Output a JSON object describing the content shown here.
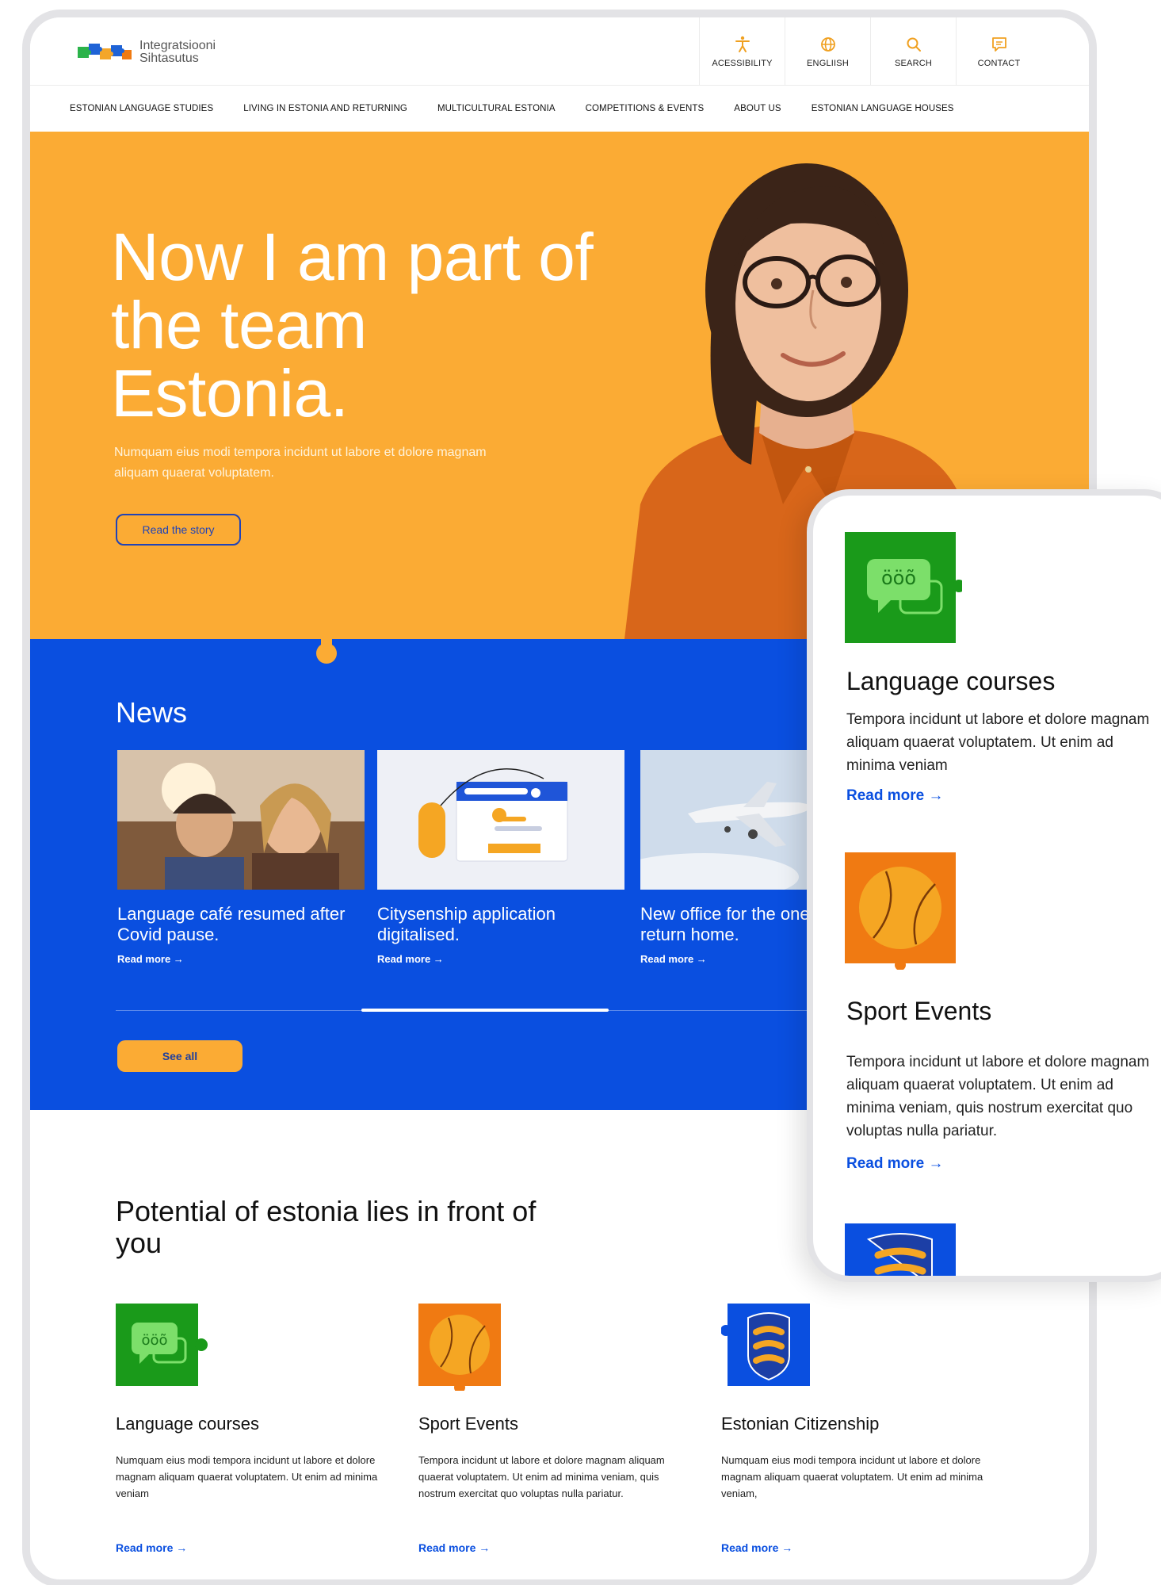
{
  "header": {
    "logo_line1": "Integratsiooni",
    "logo_line2": "Sihtasutus",
    "utility": [
      {
        "label": "ACESSIBILITY",
        "icon": "accessibility-icon"
      },
      {
        "label": "ENGLIISH",
        "icon": "globe-icon"
      },
      {
        "label": "SEARCH",
        "icon": "search-icon"
      },
      {
        "label": "CONTACT",
        "icon": "chat-icon"
      }
    ],
    "nav": [
      "ESTONIAN LANGUAGE STUDIES",
      "LIVING IN ESTONIA AND RETURNING",
      "MULTICULTURAL ESTONIA",
      "COMPETITIONS & EVENTS",
      "ABOUT US",
      "ESTONIAN LANGUAGE HOUSES"
    ]
  },
  "hero": {
    "title": "Now I am part of the team Estonia.",
    "subtitle": "Numquam eius modi tempora incidunt ut labore et dolore magnam aliquam quaerat voluptatem.",
    "button": "Read the story"
  },
  "news": {
    "title": "News",
    "items": [
      {
        "headline": "Language café resumed after Covid pause.",
        "link": "Read more →"
      },
      {
        "headline": "Citysenship application digitalised.",
        "link": "Read more →"
      },
      {
        "headline": "New office for the ones who return home.",
        "link": "Read more →"
      }
    ],
    "see_all": "See all"
  },
  "potential": {
    "title": "Potential of estonia lies in front of you",
    "features": [
      {
        "title": "Language courses",
        "desc": "Numquam eius modi tempora incidunt ut labore et dolore magnam aliquam quaerat voluptatem. Ut enim ad minima veniam",
        "link": "Read more →",
        "icon": "speech-bubbles-icon"
      },
      {
        "title": "Sport Events",
        "desc": "Tempora incidunt ut labore et dolore magnam aliquam quaerat voluptatem. Ut enim ad minima veniam, quis nostrum exercitat quo voluptas nulla pariatur.",
        "link": "Read more →",
        "icon": "ball-icon"
      },
      {
        "title": "Estonian Citizenship",
        "desc": "Numquam eius modi tempora incidunt ut labore et dolore magnam aliquam quaerat voluptatem. Ut enim ad minima veniam,",
        "link": "Read more →",
        "icon": "coat-of-arms-icon"
      }
    ]
  },
  "mobile": {
    "cards": [
      {
        "title": "Language courses",
        "desc": "Tempora incidunt ut labore et dolore magnam aliquam quaerat voluptatem. Ut enim ad minima veniam",
        "link": "Read more →"
      },
      {
        "title": "Sport Events",
        "desc": "Tempora incidunt ut labore et dolore magnam aliquam quaerat voluptatem. Ut enim ad minima veniam, quis nostrum exercitat quo voluptas nulla pariatur.",
        "link": "Read more →"
      }
    ]
  },
  "colors": {
    "orange": "#fbab34",
    "blue": "#0a4fe0",
    "green": "#1a9a1a",
    "deep_orange": "#f07a12"
  }
}
